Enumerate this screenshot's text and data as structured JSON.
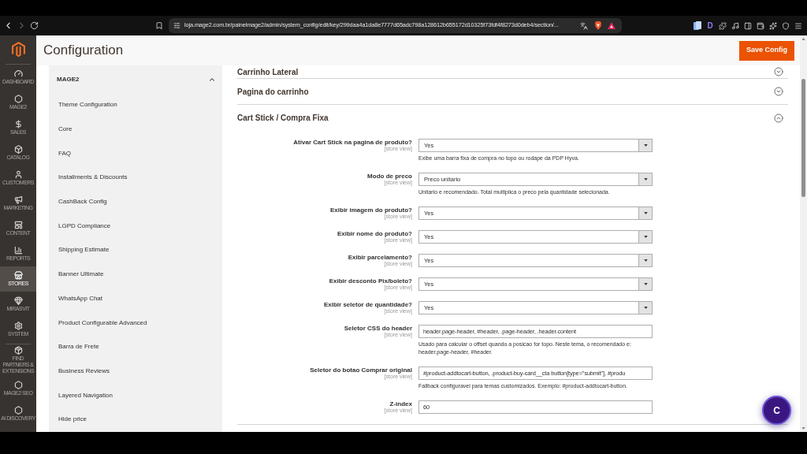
{
  "browser": {
    "url": "loja.mage2.com.br/painelmage2/admin/system_config/edit/key/299daa4a1da8e7777d65adc798a128612b655172d10325f73fdf4f8273d0deb4/section/...",
    "forward_disabled": true,
    "extension_letter": "D"
  },
  "admin_menu": {
    "items": [
      {
        "label": "DASHBOARD",
        "selected": false
      },
      {
        "label": "MAGE2",
        "selected": false
      },
      {
        "label": "SALES",
        "selected": false
      },
      {
        "label": "CATALOG",
        "selected": false
      },
      {
        "label": "CUSTOMERS",
        "selected": false
      },
      {
        "label": "MARKETING",
        "selected": false
      },
      {
        "label": "CONTENT",
        "selected": false
      },
      {
        "label": "REPORTS",
        "selected": false
      },
      {
        "label": "STORES",
        "selected": true
      },
      {
        "label": "MIRASVIT",
        "selected": false
      },
      {
        "label": "SYSTEM",
        "selected": false
      }
    ],
    "extension_items": [
      {
        "label": "FIND PARTNERS & EXTENSIONS",
        "selected": false
      },
      {
        "label": "MAGE2 SEO",
        "selected": false
      },
      {
        "label": "AI DISCOVERY",
        "selected": false
      }
    ]
  },
  "page_header": {
    "title": "Configuration",
    "save_button": "Save Config"
  },
  "config_tabs": {
    "group": "MAGE2",
    "expanded": true,
    "items": [
      {
        "label": "Theme Configuration",
        "selected": false
      },
      {
        "label": "Core",
        "selected": false
      },
      {
        "label": "FAQ",
        "selected": false
      },
      {
        "label": "Installments & Discounts",
        "selected": false
      },
      {
        "label": "CashBack Config",
        "selected": false
      },
      {
        "label": "LGPD Compliance",
        "selected": false
      },
      {
        "label": "Shipping Estimate",
        "selected": false
      },
      {
        "label": "Banner Ultimate",
        "selected": false
      },
      {
        "label": "WhatsApp Chat",
        "selected": false
      },
      {
        "label": "Product Configurable Advanced",
        "selected": false
      },
      {
        "label": "Barra de Frete",
        "selected": false
      },
      {
        "label": "Business Reviews",
        "selected": false
      },
      {
        "label": "Layered Navigation",
        "selected": false
      },
      {
        "label": "Hide price",
        "selected": false
      }
    ]
  },
  "sections": [
    {
      "title": "Carrinho Lateral",
      "expanded": false
    },
    {
      "title": "Pagina do carrinho",
      "expanded": false
    },
    {
      "title": "Cart Stick / Compra Fixa",
      "expanded": true,
      "fields": [
        {
          "kind": "select",
          "label": "Ativar Cart Stick na pagina de produto?",
          "scope": "[store view]",
          "value": "Yes",
          "note": "Exibe uma barra fixa de compra no topo ou rodape da PDP Hyva."
        },
        {
          "kind": "select",
          "label": "Modo de preco",
          "scope": "[store view]",
          "value": "Preco unitario",
          "note": "Unitario e recomendado. Total multiplica o preco pela quantidade selecionada."
        },
        {
          "kind": "select",
          "label": "Exibir imagem do produto?",
          "scope": "[store view]",
          "value": "Yes"
        },
        {
          "kind": "select",
          "label": "Exibir nome do produto?",
          "scope": "[store view]",
          "value": "Yes"
        },
        {
          "kind": "select",
          "label": "Exibir parcelamento?",
          "scope": "[store view]",
          "value": "Yes"
        },
        {
          "kind": "select",
          "label": "Exibir desconto Pix/boleto?",
          "scope": "[store view]",
          "value": "Yes"
        },
        {
          "kind": "select",
          "label": "Exibir seletor de quantidade?",
          "scope": "[store view]",
          "value": "Yes"
        },
        {
          "kind": "text",
          "label": "Seletor CSS do header",
          "scope": "[store view]",
          "value": "header.page-header, #header, .page-header, .header.content",
          "note": "Usado para calcular o offset quando a posicao for topo. Neste tema, o recomendado e: header.page-header, #header."
        },
        {
          "kind": "text",
          "label": "Seletor do botao Comprar original",
          "scope": "[store view]",
          "value": "#product-addtocart-button, .product-buy-card__cta button[type=\"submit\"], #produ",
          "note": "Fallback configuravel para temas customizados. Exemplo: #product-addtocart-button."
        },
        {
          "kind": "text",
          "label": "Z-index",
          "scope": "[store view]",
          "value": "60"
        }
      ]
    }
  ],
  "chat_button": {
    "label": "C"
  }
}
